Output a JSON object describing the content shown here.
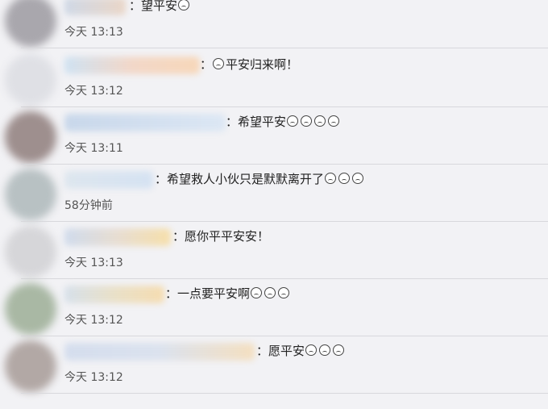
{
  "comments": [
    {
      "text": "：望平安",
      "emoji_count": 1,
      "time": "今天 13:13"
    },
    {
      "text": "：",
      "emoji_count": 1,
      "text_after": "平安归来啊！",
      "time": "今天 13:12"
    },
    {
      "text": "：希望平安",
      "emoji_count": 4,
      "time": "今天 13:11"
    },
    {
      "text": "：希望救人小伙只是默默离开了",
      "emoji_count": 3,
      "time": "58分钟前"
    },
    {
      "text": "：愿你平平安安！",
      "emoji_count": 0,
      "time": "今天 13:13"
    },
    {
      "text": "：一点要平安啊",
      "emoji_count": 3,
      "time": "今天 13:12"
    },
    {
      "text": "：愿平安",
      "emoji_count": 3,
      "time": "今天 13:12"
    }
  ],
  "emoji_icon": "crying-face-icon"
}
